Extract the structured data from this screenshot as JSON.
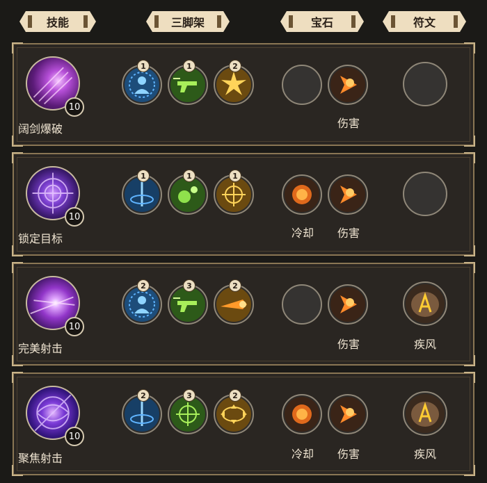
{
  "tabs": [
    "技能",
    "三脚架",
    "宝石",
    "符文"
  ],
  "skills": [
    {
      "name": "阔剑爆破",
      "level": "10",
      "tripods": [
        "1",
        "1",
        "2"
      ],
      "gem_labels": [
        "",
        "伤害"
      ],
      "rune_label": ""
    },
    {
      "name": "锁定目标",
      "level": "10",
      "tripods": [
        "1",
        "1",
        "1"
      ],
      "gem_labels": [
        "冷却",
        "伤害"
      ],
      "rune_label": ""
    },
    {
      "name": "完美射击",
      "level": "10",
      "tripods": [
        "2",
        "3",
        "2"
      ],
      "gem_labels": [
        "",
        "伤害"
      ],
      "rune_label": "疾风"
    },
    {
      "name": "聚焦射击",
      "level": "10",
      "tripods": [
        "2",
        "3",
        "2"
      ],
      "gem_labels": [
        "冷却",
        "伤害"
      ],
      "rune_label": "疾风"
    }
  ]
}
